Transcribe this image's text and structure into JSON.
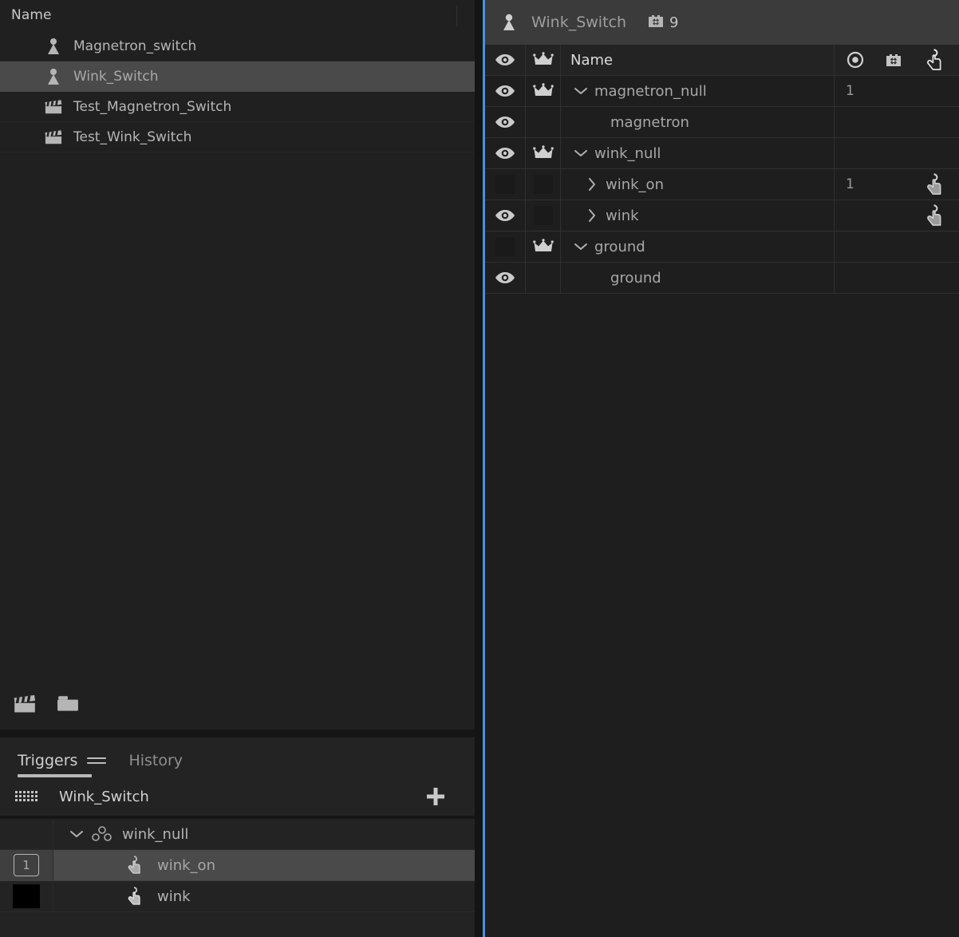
{
  "assets_panel": {
    "header": {
      "name_column": "Name"
    },
    "items": [
      {
        "label": "Magnetron_switch",
        "icon": "prefab-icon",
        "selected": false
      },
      {
        "label": "Wink_Switch",
        "icon": "prefab-icon",
        "selected": true
      },
      {
        "label": "Test_Magnetron_Switch",
        "icon": "clapperboard-icon",
        "selected": false
      },
      {
        "label": "Test_Wink_Switch",
        "icon": "clapperboard-icon",
        "selected": false
      }
    ],
    "footer_buttons": [
      {
        "icon": "clapperboard-icon",
        "name": "new-scene-button"
      },
      {
        "icon": "folder-icon",
        "name": "new-folder-button"
      }
    ]
  },
  "triggers_panel": {
    "tabs": [
      {
        "label": "Triggers",
        "active": true
      },
      {
        "label": "History",
        "active": false
      }
    ],
    "menu_icon": "hamburger-menu-icon",
    "subheader": {
      "icon": "keyboard-icon",
      "title": "Wink_Switch",
      "add_label": "+"
    },
    "rows": [
      {
        "number": "",
        "number_style": "none",
        "twisty": "expanded",
        "icon": "null-object-icon",
        "label": "wink_null",
        "selected": false
      },
      {
        "number": "1",
        "number_style": "outlined",
        "twisty": "none",
        "icon": "hand-click-icon",
        "label": "wink_on",
        "selected": true
      },
      {
        "number": "",
        "number_style": "black",
        "twisty": "none",
        "icon": "hand-click-icon",
        "label": "wink",
        "selected": false
      }
    ]
  },
  "hierarchy_panel": {
    "header": {
      "icon": "prefab-icon",
      "title": "Wink_Switch",
      "badge_icon": "gear-box-icon",
      "badge_count": "9"
    },
    "columns": {
      "visibility": "eye-icon",
      "pin": "crown-icon",
      "name": "Name",
      "target": "target-icon",
      "gear": "gear-box-icon",
      "interaction": "hand-click-icon"
    },
    "rows": [
      {
        "eye": "visible",
        "crown": true,
        "twisty": "expanded",
        "indent": 0,
        "name": "magnetron_null",
        "num": "1",
        "gear": false,
        "hand": false
      },
      {
        "eye": "visible",
        "crown": false,
        "twisty": "none",
        "indent": 1,
        "name": "magnetron",
        "num": "",
        "gear": false,
        "hand": false
      },
      {
        "eye": "visible",
        "crown": true,
        "twisty": "expanded",
        "indent": 0,
        "name": "wink_null",
        "num": "",
        "gear": false,
        "hand": false
      },
      {
        "eye": "hidden",
        "crown": "box",
        "twisty": "collapsed",
        "indent": 1,
        "name": "wink_on",
        "num": "1",
        "gear": false,
        "hand": true
      },
      {
        "eye": "visible",
        "crown": "box",
        "twisty": "collapsed",
        "indent": 1,
        "name": "wink",
        "num": "",
        "gear": false,
        "hand": true
      },
      {
        "eye": "hidden",
        "crown": true,
        "twisty": "expanded",
        "indent": 0,
        "name": "ground",
        "num": "",
        "gear": false,
        "hand": false
      },
      {
        "eye": "visible",
        "crown": false,
        "twisty": "none",
        "indent": 1,
        "name": "ground",
        "num": "",
        "gear": false,
        "hand": false
      }
    ]
  },
  "colors": {
    "accent": "#4a90e2",
    "panel_bg": "#1e1e1e",
    "header_bg": "#3b3b3b",
    "selection": "#4a4a4a",
    "text": "#b0b0b0"
  }
}
